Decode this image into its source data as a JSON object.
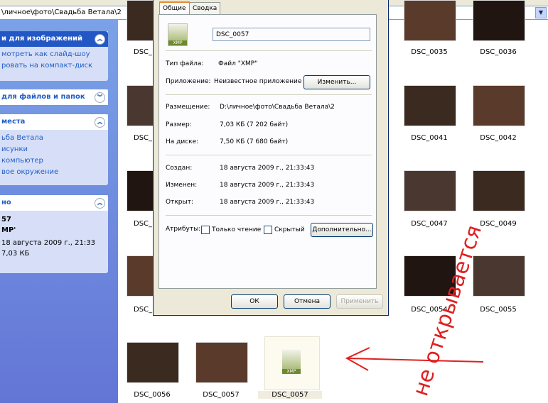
{
  "address": {
    "path": "\\личное\\фото\\Свадьба Ветала\\2"
  },
  "left_pane": {
    "picture_tasks": {
      "title": "и для изображений",
      "items": [
        "мотреть как слайд-шоу",
        "ровать на компакт-диск"
      ]
    },
    "file_tasks": {
      "title": "для файлов и папок"
    },
    "places": {
      "title": "места",
      "items": [
        "ьба Ветала",
        "исунки",
        "компьютер",
        "вое окружение"
      ]
    },
    "details": {
      "title": "но",
      "lines": [
        "57",
        "MP'",
        "18 августа 2009 г., 21:33",
        "7,03 КБ"
      ]
    }
  },
  "files": [
    {
      "name": "DSC_"
    },
    {
      "name": "DSC_0035"
    },
    {
      "name": "DSC_0036"
    },
    {
      "name": "DSC_"
    },
    {
      "name": "DSC_0041"
    },
    {
      "name": "DSC_0042"
    },
    {
      "name": "DSC_"
    },
    {
      "name": "DSC_0047"
    },
    {
      "name": "DSC_0049"
    },
    {
      "name": "DSC_"
    },
    {
      "name": "DSC_0054"
    },
    {
      "name": "DSC_0055"
    },
    {
      "name": "DSC_0056"
    },
    {
      "name": "DSC_0057"
    },
    {
      "name": "DSC_0057",
      "type": "XMP",
      "selected": true
    }
  ],
  "dialog": {
    "tabs": [
      "Общие",
      "Сводка"
    ],
    "filename": "DSC_0057",
    "icon_label": "XMP",
    "rows": [
      {
        "label": "Тип файла:",
        "value": "Файл \"XMP\""
      },
      {
        "label": "Приложение:",
        "value": "Неизвестное приложение"
      },
      {
        "label": "Размещение:",
        "value": "D:\\личное\\фото\\Свадьба Ветала\\2"
      },
      {
        "label": "Размер:",
        "value": "7,03 КБ (7 202 байт)"
      },
      {
        "label": "На диске:",
        "value": "7,50 КБ (7 680 байт)"
      },
      {
        "label": "Создан:",
        "value": "18 августа 2009 г., 21:33:43"
      },
      {
        "label": "Изменен:",
        "value": "18 августа 2009 г., 21:33:43"
      },
      {
        "label": "Открыт:",
        "value": "18 августа 2009 г., 21:33:43"
      }
    ],
    "change_btn": "Изменить...",
    "attributes_label": "Атрибуты:",
    "readonly": "Только чтение",
    "hidden": "Скрытый",
    "advanced_btn": "Дополнительно...",
    "ok": "ОК",
    "cancel": "Отмена",
    "apply": "Применить"
  },
  "annotation": {
    "text": "не открывается",
    "color": "#e02020"
  }
}
